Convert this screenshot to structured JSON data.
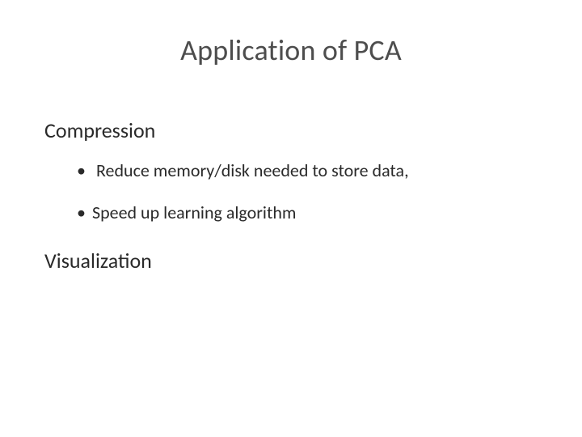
{
  "title": "Application of PCA",
  "sections": {
    "compression": {
      "heading": "Compression",
      "bullets": [
        " Reduce memory/disk needed to store data,",
        "Speed up learning algorithm"
      ]
    },
    "visualization": {
      "heading": "Visualization"
    }
  },
  "glyph": {
    "bullet": "•"
  }
}
